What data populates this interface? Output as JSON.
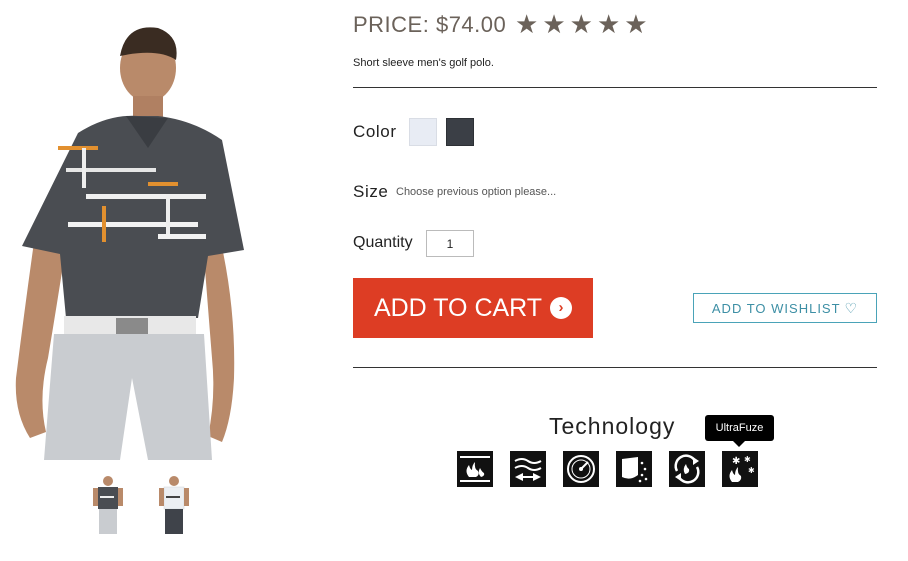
{
  "product": {
    "price": "PRICE: $74.00",
    "rating": 5,
    "description": "Short sleeve men's golf polo."
  },
  "options": {
    "color_label": "Color",
    "colors": [
      "white",
      "charcoal"
    ],
    "size_label": "Size",
    "size_hint": "Choose previous option please...",
    "quantity_label": "Quantity",
    "quantity_value": "1"
  },
  "actions": {
    "add_to_cart": "ADD TO CART",
    "add_to_wishlist": "ADD TO WISHLIST"
  },
  "technology": {
    "title": "Technology",
    "tooltip": "UltraFuze",
    "icons": [
      "heat-icon",
      "airflow-icon",
      "gauge-icon",
      "shield-icon",
      "recycle-icon",
      "ultrafuze-icon"
    ]
  },
  "colors": {
    "accent_red": "#dd3d24",
    "wishlist_teal": "#3d8fa5",
    "star": "#6b625a"
  }
}
